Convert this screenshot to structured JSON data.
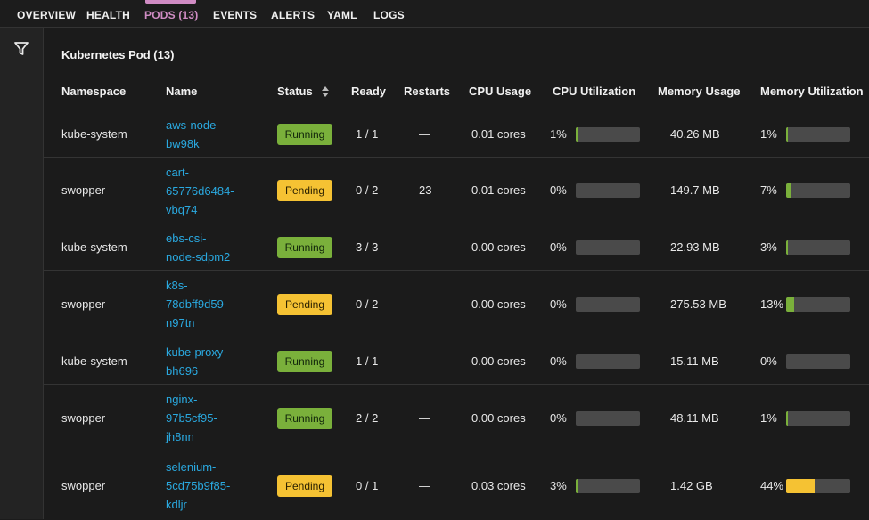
{
  "tabs": [
    {
      "label": "OVERVIEW"
    },
    {
      "label": "HEALTH"
    },
    {
      "label": "PODS (13)"
    },
    {
      "label": "EVENTS"
    },
    {
      "label": "ALERTS"
    },
    {
      "label": "YAML"
    },
    {
      "label": "LOGS"
    }
  ],
  "active_tab": "PODS (13)",
  "panel": {
    "title": "Kubernetes Pod (13)"
  },
  "columns": {
    "namespace": "Namespace",
    "name": "Name",
    "status": "Status",
    "ready": "Ready",
    "restarts": "Restarts",
    "cpu_usage": "CPU Usage",
    "cpu_util": "CPU Utilization",
    "mem_usage": "Memory Usage",
    "mem_util": "Memory Utilization"
  },
  "colors": {
    "running": "#7ab03b",
    "pending": "#f5c233",
    "link": "#2aa9e0",
    "active_tab": "#d08cc4"
  },
  "icons": {
    "filter": "filter-icon",
    "sort": "sort-icon"
  },
  "rows": [
    {
      "namespace": "kube-system",
      "name_lines": [
        "aws-node-",
        "bw98k"
      ],
      "status": "Running",
      "ready": "1 / 1",
      "restarts": "—",
      "cpu_usage": "0.01 cores",
      "cpu_util": "1%",
      "cpu_fraction": 0.01,
      "mem_usage": "40.26 MB",
      "mem_util": "1%",
      "mem_fraction": 0.01
    },
    {
      "namespace": "swopper",
      "name_lines": [
        "cart-",
        "65776d6484-",
        "vbq74"
      ],
      "status": "Pending",
      "ready": "0 / 2",
      "restarts": "23",
      "cpu_usage": "0.01 cores",
      "cpu_util": "0%",
      "cpu_fraction": 0.0,
      "mem_usage": "149.7 MB",
      "mem_util": "7%",
      "mem_fraction": 0.07
    },
    {
      "namespace": "kube-system",
      "name_lines": [
        "ebs-csi-",
        "node-sdpm2"
      ],
      "status": "Running",
      "ready": "3 / 3",
      "restarts": "—",
      "cpu_usage": "0.00 cores",
      "cpu_util": "0%",
      "cpu_fraction": 0.0,
      "mem_usage": "22.93 MB",
      "mem_util": "3%",
      "mem_fraction": 0.03
    },
    {
      "namespace": "swopper",
      "name_lines": [
        "k8s-",
        "78dbff9d59-",
        "n97tn"
      ],
      "status": "Pending",
      "ready": "0 / 2",
      "restarts": "—",
      "cpu_usage": "0.00 cores",
      "cpu_util": "0%",
      "cpu_fraction": 0.0,
      "mem_usage": "275.53 MB",
      "mem_util": "13%",
      "mem_fraction": 0.13
    },
    {
      "namespace": "kube-system",
      "name_lines": [
        "kube-proxy-",
        "bh696"
      ],
      "status": "Running",
      "ready": "1 / 1",
      "restarts": "—",
      "cpu_usage": "0.00 cores",
      "cpu_util": "0%",
      "cpu_fraction": 0.0,
      "mem_usage": "15.11 MB",
      "mem_util": "0%",
      "mem_fraction": 0.0
    },
    {
      "namespace": "swopper",
      "name_lines": [
        "nginx-",
        "97b5cf95-",
        "jh8nn"
      ],
      "status": "Running",
      "ready": "2 / 2",
      "restarts": "—",
      "cpu_usage": "0.00 cores",
      "cpu_util": "0%",
      "cpu_fraction": 0.0,
      "mem_usage": "48.11 MB",
      "mem_util": "1%",
      "mem_fraction": 0.01
    },
    {
      "namespace": "swopper",
      "name_lines": [
        "selenium-",
        "5cd75b9f85-",
        "kdljr"
      ],
      "status": "Pending",
      "ready": "0 / 1",
      "restarts": "—",
      "cpu_usage": "0.03 cores",
      "cpu_util": "3%",
      "cpu_fraction": 0.03,
      "mem_usage": "1.42 GB",
      "mem_util": "44%",
      "mem_fraction": 0.44
    }
  ]
}
